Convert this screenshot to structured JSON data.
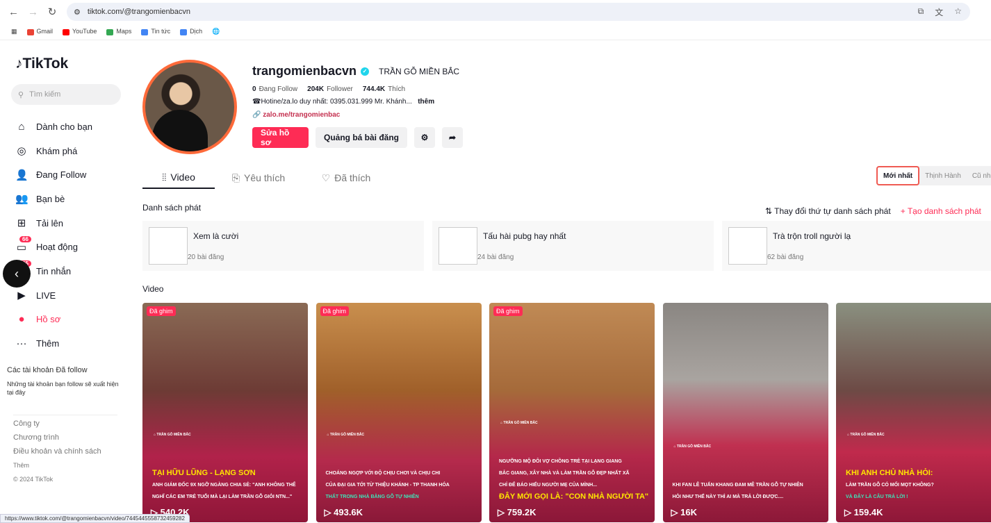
{
  "browser": {
    "url": "tiktok.com/@trangomienbacvn",
    "bookmarks": [
      "Gmail",
      "YouTube",
      "Maps",
      "Tin tức",
      "Dịch"
    ],
    "status_url": "https://www.tiktok.com/@trangomienbacvn/video/7445445558732459282"
  },
  "sidebar": {
    "logo": "TikTok",
    "search_placeholder": "Tìm kiếm",
    "items": [
      {
        "label": "Dành cho bạn",
        "icon": "⌂"
      },
      {
        "label": "Khám phá",
        "icon": "◎"
      },
      {
        "label": "Đang Follow",
        "icon": "👤"
      },
      {
        "label": "Bạn bè",
        "icon": "👥"
      },
      {
        "label": "Tải lên",
        "icon": "⊞"
      },
      {
        "label": "Hoạt động",
        "icon": "▭",
        "badge": "66"
      },
      {
        "label": "Tin nhắn",
        "icon": "✉",
        "badge": "35"
      },
      {
        "label": "LIVE",
        "icon": "▶"
      },
      {
        "label": "Hồ sơ",
        "icon": "●"
      },
      {
        "label": "Thêm",
        "icon": "···"
      }
    ],
    "following_title": "Các tài khoản Đã follow",
    "following_desc": "Những tài khoản bạn follow sẽ xuất hiện tại đây",
    "footer": [
      "Công ty",
      "Chương trình",
      "Điều khoản và chính sách",
      "Thêm",
      "© 2024 TikTok"
    ]
  },
  "profile": {
    "username": "trangomienbacvn",
    "nickname": "TRẦN GỖ MIỀN BẮC",
    "following": "0",
    "following_label": "Đang Follow",
    "followers": "204K",
    "followers_label": "Follower",
    "likes": "744.4K",
    "likes_label": "Thích",
    "bio": "☎Hotine/za.lo duy nhất: 0395.031.999 Mr. Khánh...",
    "more": "thêm",
    "link": "zalo.me/trangomienbac",
    "edit_btn": "Sửa hồ sơ",
    "promote_btn": "Quảng bá bài đăng"
  },
  "tabs": [
    "Video",
    "Yêu thích",
    "Đã thích"
  ],
  "sort": [
    "Mới nhất",
    "Thịnh Hành",
    "Cũ nhất"
  ],
  "playlists": {
    "title": "Danh sách phát",
    "reorder": "Thay đổi thứ tự danh sách phát",
    "create": "Tạo danh sách phát",
    "items": [
      {
        "name": "Xem là cười",
        "count": "20 bài đăng"
      },
      {
        "name": "Tấu hài pubg hay nhất",
        "count": "24 bài đăng"
      },
      {
        "name": "Trà trộn troll người lạ",
        "count": "62 bài đăng"
      }
    ]
  },
  "videos_title": "Video",
  "videos": [
    {
      "pinned": "Đã ghim",
      "views": "540.2K",
      "lines": [
        "TẠI HỮU LŨNG - LẠNG SƠN",
        "ANH GIÁM ĐỐC 9X NGỠ NGÀNG CHIA SẺ: \"ANH KHÔNG THỂ",
        "NGHĨ CÁC EM TRẺ TUỔI MÀ LẠI LÀM TRẦN GỖ GIỎI NTN...\""
      ]
    },
    {
      "pinned": "Đã ghim",
      "views": "493.6K",
      "lines": [
        "CHOÁNG NGỢP VỚI ĐỘ CHỊU CHƠI VÀ CHỊU CHI",
        "CỦA ĐẠI GIA TỚI TỪ THIỆU KHÁNH - TP THANH HÓA",
        "THẤT TRONG NHÀ BẰNG GỖ TỰ NHIÊN"
      ]
    },
    {
      "pinned": "Đã ghim",
      "views": "759.2K",
      "lines": [
        "NGƯỠNG MỘ ĐÔI VỢ CHỒNG TRẺ TẠI LẠNG GIANG",
        "BẮC GIANG, XÂY NHÀ VÀ LÀM TRẦN GỖ ĐẸP NHẤT XÃ",
        "CHỈ ĐỂ BÁO HIẾU NGƯỜI MẸ CỦA MÌNH...",
        "ĐÂY MỚI GỌI LÀ: \"CON NHÀ NGƯỜI TA\""
      ]
    },
    {
      "views": "16K",
      "lines": [
        "KHI FAN LÊ TUẤN KHANG ĐAM MÊ TRẦN GỖ TỰ NHIÊN",
        "HỎI NHƯ THẾ NÀY THÌ AI MÀ TRẢ LỜI ĐƯỢC...."
      ]
    },
    {
      "views": "159.4K",
      "lines": [
        "KHI ANH CHỦ NHÀ HỎI:",
        "LÀM TRẦN GỖ CÓ MỐI MỌT KHÔNG?",
        "VÀ ĐÂY LÀ CÂU TRẢ LỜI !"
      ]
    }
  ],
  "brand_watermark": "TRẦN GỖ MIỀN BẮC",
  "colors": {
    "accent": "#fe2c55",
    "verified": "#20d5ec"
  }
}
